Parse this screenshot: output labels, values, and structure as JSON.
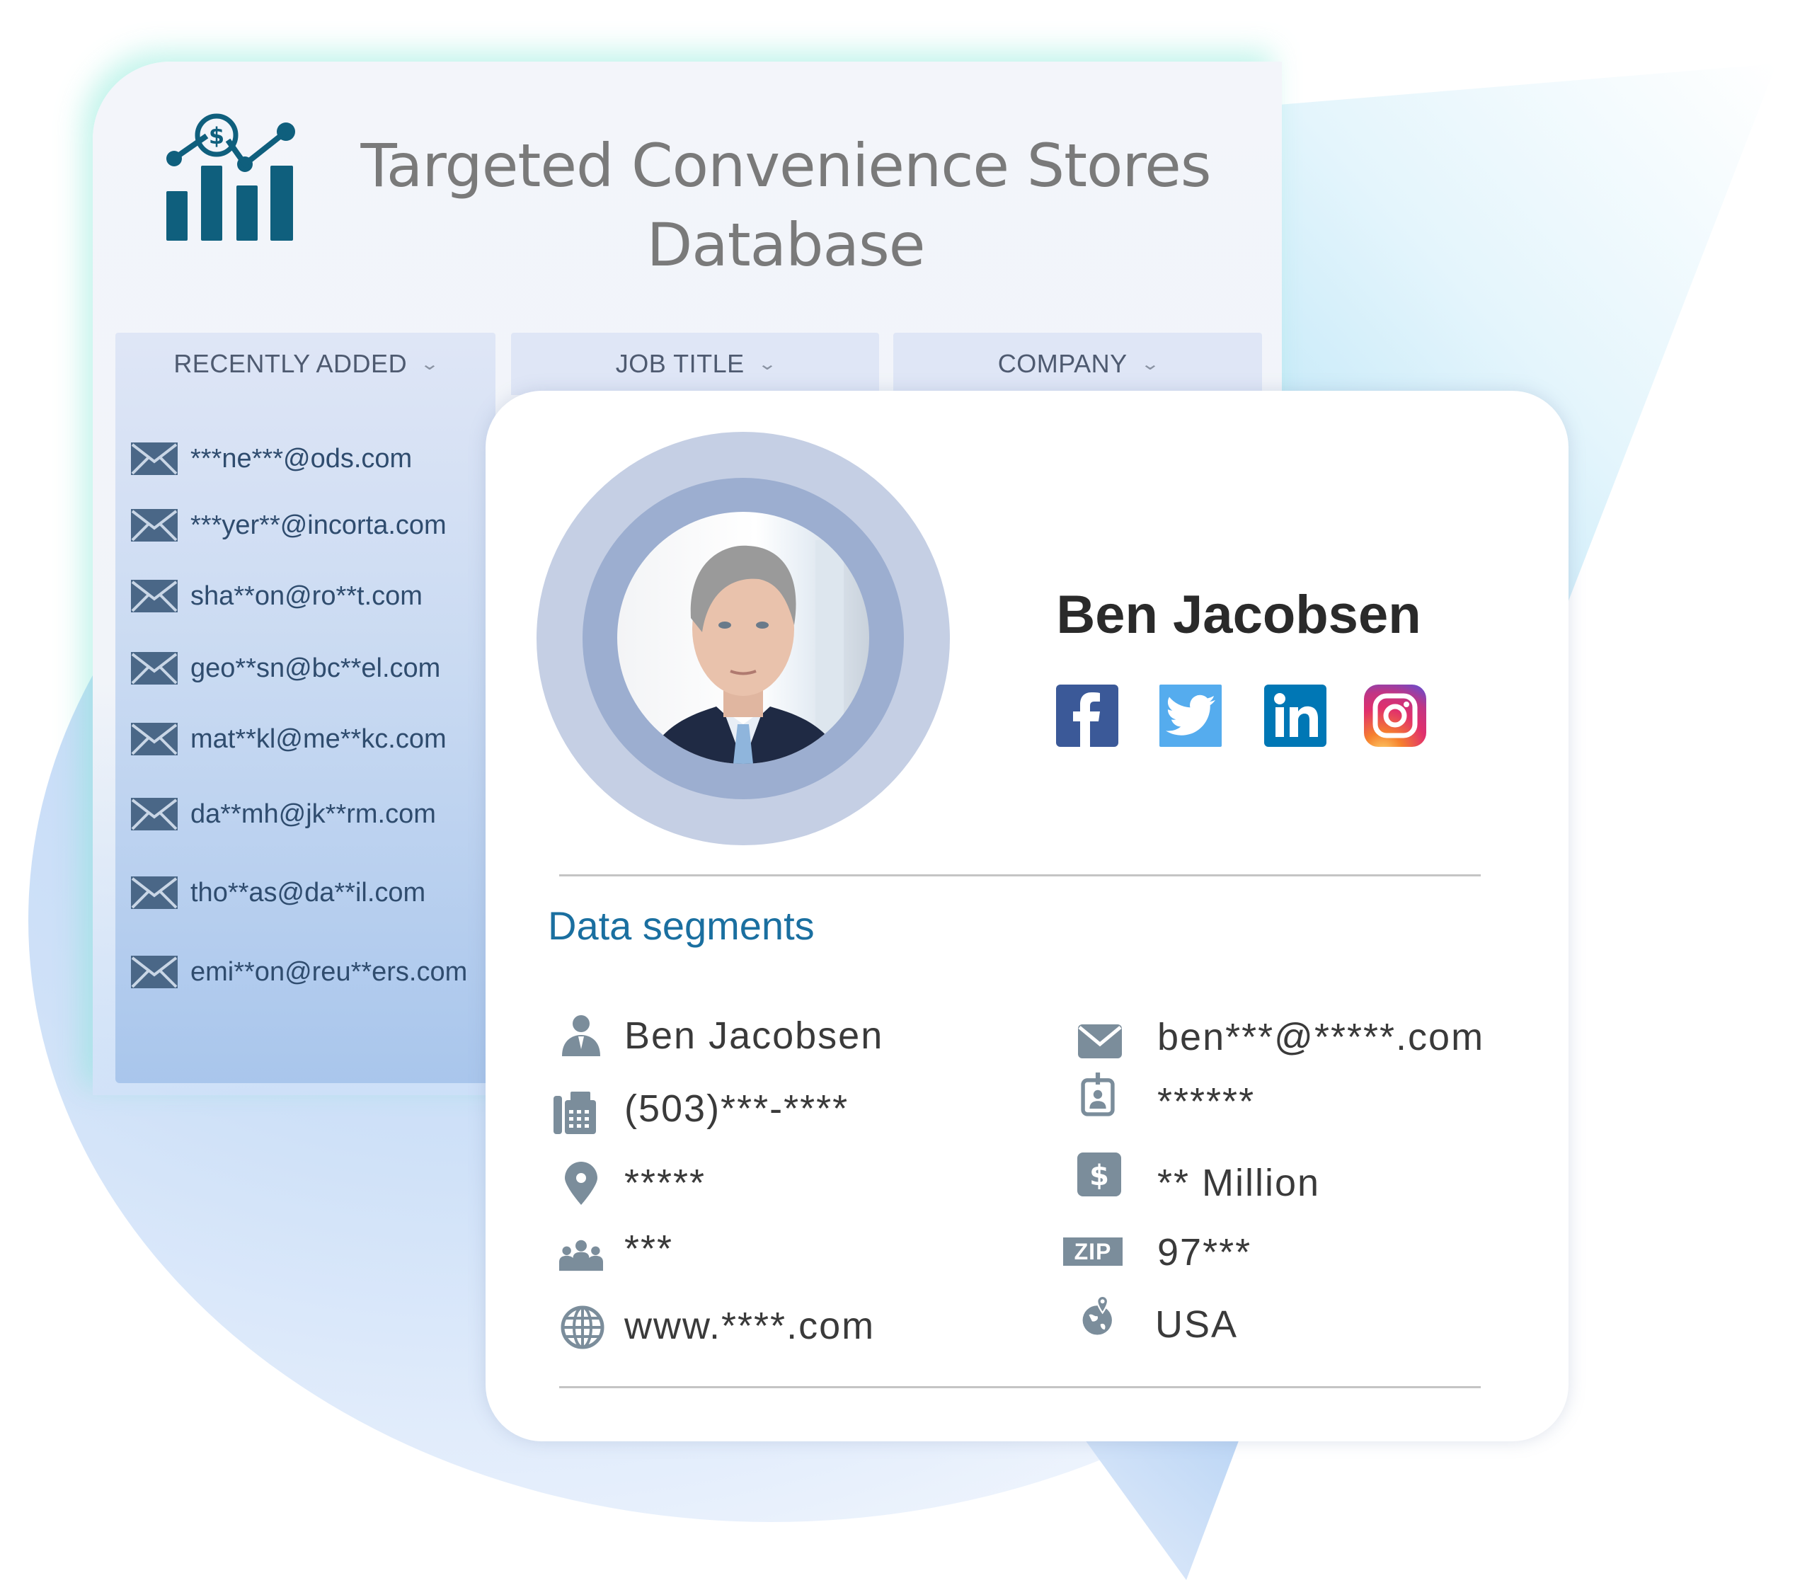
{
  "header": {
    "title": "Targeted Convenience Stores Database",
    "logo_icon": "bar-chart-dollar-icon"
  },
  "tabs": [
    {
      "label": "RECENTLY ADDED",
      "icon": "chevron-down-icon"
    },
    {
      "label": "JOB TITLE",
      "icon": "chevron-down-icon"
    },
    {
      "label": "COMPANY",
      "icon": "chevron-down-icon"
    }
  ],
  "recent_emails": [
    "***ne***@ods.com",
    "***yer**@incorta.com",
    "sha**on@ro**t.com",
    "geo**sn@bc**el.com",
    "mat**kl@me**kc.com",
    "da**mh@jk**rm.com",
    "tho**as@da**il.com",
    "emi**on@reu**ers.com"
  ],
  "profile": {
    "name": "Ben Jacobsen",
    "social": [
      {
        "name": "facebook",
        "icon": "facebook-icon",
        "color": "#3b5998"
      },
      {
        "name": "twitter",
        "icon": "twitter-icon",
        "color": "#55acee"
      },
      {
        "name": "linkedin",
        "icon": "linkedin-icon",
        "color": "#0077b5"
      },
      {
        "name": "instagram",
        "icon": "instagram-icon",
        "color": "#c13584"
      }
    ]
  },
  "segments": {
    "title": "Data segments",
    "left": [
      {
        "icon": "person-icon",
        "value": "Ben Jacobsen"
      },
      {
        "icon": "fax-phone-icon",
        "value": "(503)***-****"
      },
      {
        "icon": "location-pin-icon",
        "value": "*****"
      },
      {
        "icon": "team-icon",
        "value": "***"
      },
      {
        "icon": "globe-icon",
        "value": "www.****.com"
      }
    ],
    "right": [
      {
        "icon": "envelope-icon",
        "value": "ben***@*****.com"
      },
      {
        "icon": "id-badge-icon",
        "value": "******"
      },
      {
        "icon": "dollar-icon",
        "value": "** Million"
      },
      {
        "icon": "zip-icon",
        "value": "97***",
        "icon_label": "ZIP"
      },
      {
        "icon": "world-pin-icon",
        "value": "USA"
      }
    ]
  },
  "colors": {
    "accent": "#1a6fa0",
    "logo": "#0f5f7d",
    "icon_gray": "#7b8d9b",
    "email_text": "#2f4c6e"
  }
}
